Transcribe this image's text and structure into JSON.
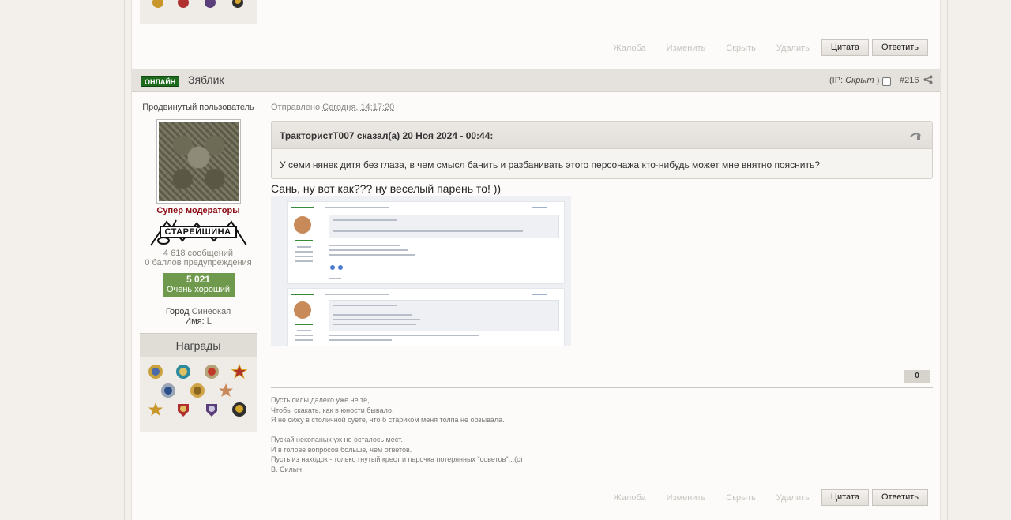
{
  "prev_post": {
    "actions": {
      "complaint": "Жалоба",
      "edit": "Изменить",
      "hide": "Скрыть",
      "delete": "Удалить",
      "quote": "Цитата",
      "reply": "Ответить"
    }
  },
  "post": {
    "status": "ОНЛАЙН",
    "author": "Зяблик",
    "ip_prefix": "(IP: ",
    "ip_value": "Скрыт",
    "ip_suffix": ")",
    "number": "#216",
    "user": {
      "rank": "Продвинутый пользователь",
      "group": "Супер модераторы",
      "badge": "СТАРЕЙШИНА",
      "messages": "4 618 сообщений",
      "warnings": "0 баллов предупреждения",
      "reputation_value": "5 021",
      "reputation_label": "Очень хороший",
      "city_label": "Город",
      "city_value": "Синеокая",
      "name_label": "Имя:",
      "name_value": "L",
      "awards_title": "Награды"
    },
    "sent_label": "Отправлено",
    "sent_time": "Сегодня, 14:17:20",
    "quote": {
      "header": "ТрактористT007 сказал(а) 20 Ноя 2024 - 00:44:",
      "body": "У семи нянек дитя без глаза, в чем смысл банить и разбанивать этого персонажа кто-нибудь может мне внятно пояснить?"
    },
    "text": "Сань, ну вот как??? ну  веселый парень то! ))",
    "likes": "0",
    "signature": [
      "Пусть силы далеко уже не те,",
      "Чтобы скакать, как в юности бывало.",
      "Я не сижу в столичной суете, что б стариком меня толпа не обзывала.",
      "",
      "Пускай некопаных уж не осталось мест.",
      "И в голове вопросов больше, чем ответов.",
      "Пусть из находок - только гнутый крест и парочка потерянных \"советов\"...(с)",
      "В. Силыч"
    ],
    "actions": {
      "complaint": "Жалоба",
      "edit": "Изменить",
      "hide": "Скрыть",
      "delete": "Удалить",
      "quote": "Цитата",
      "reply": "Ответить"
    }
  },
  "colors": {
    "online": "#1e6b1e",
    "group": "#8b0a14",
    "reputation": "#6f9a4d"
  }
}
